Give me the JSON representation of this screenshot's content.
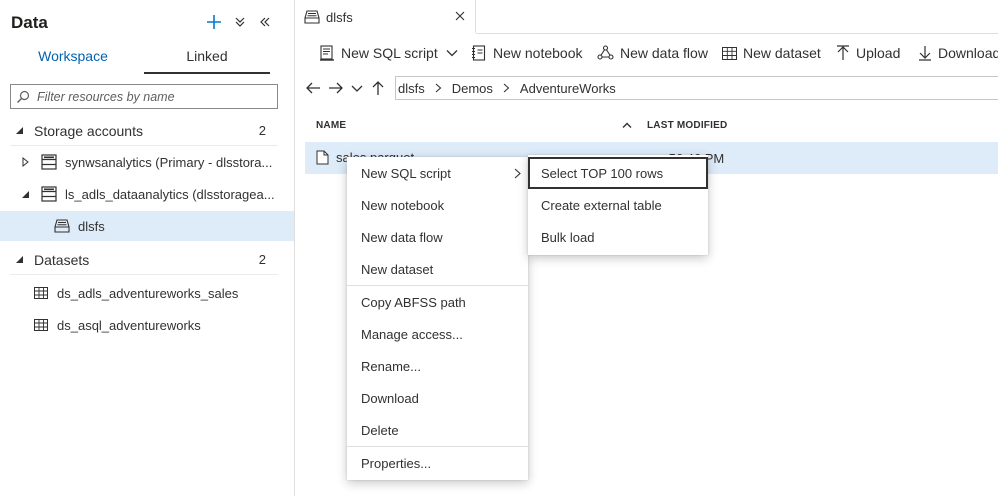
{
  "left_panel": {
    "title": "Data",
    "tabs": {
      "workspace": "Workspace",
      "linked": "Linked"
    },
    "filter_placeholder": "Filter resources by name",
    "sections": {
      "storage": {
        "label": "Storage accounts",
        "count": "2"
      },
      "datasets": {
        "label": "Datasets",
        "count": "2"
      }
    },
    "storage_items": [
      "synwsanalytics (Primary - dlsstora...",
      "ls_adls_dataanalytics (dlsstoragea..."
    ],
    "container": "dlsfs",
    "datasets": [
      "ds_adls_adventureworks_sales",
      "ds_asql_adventureworks"
    ]
  },
  "doc_tab": {
    "label": "dlsfs"
  },
  "toolbar": {
    "new_sql_script": "New SQL script",
    "new_notebook": "New notebook",
    "new_data_flow": "New data flow",
    "new_dataset": "New dataset",
    "upload": "Upload",
    "download": "Download"
  },
  "breadcrumb": [
    "dlsfs",
    "Demos",
    "AdventureWorks"
  ],
  "columns": {
    "name": "NAME",
    "last_modified": "LAST MODIFIED"
  },
  "file": {
    "name": "sales.parquet",
    "modified": ":56:46 PM"
  },
  "context_menu": {
    "items": [
      "New SQL script",
      "New notebook",
      "New data flow",
      "New dataset",
      "Copy ABFSS path",
      "Manage access...",
      "Rename...",
      "Download",
      "Delete",
      "Properties..."
    ]
  },
  "submenu": {
    "items": [
      "Select TOP 100 rows",
      "Create external table",
      "Bulk load"
    ]
  },
  "colors": {
    "accent": "#0078d4",
    "selection": "#deecf9",
    "text": "#323130"
  }
}
